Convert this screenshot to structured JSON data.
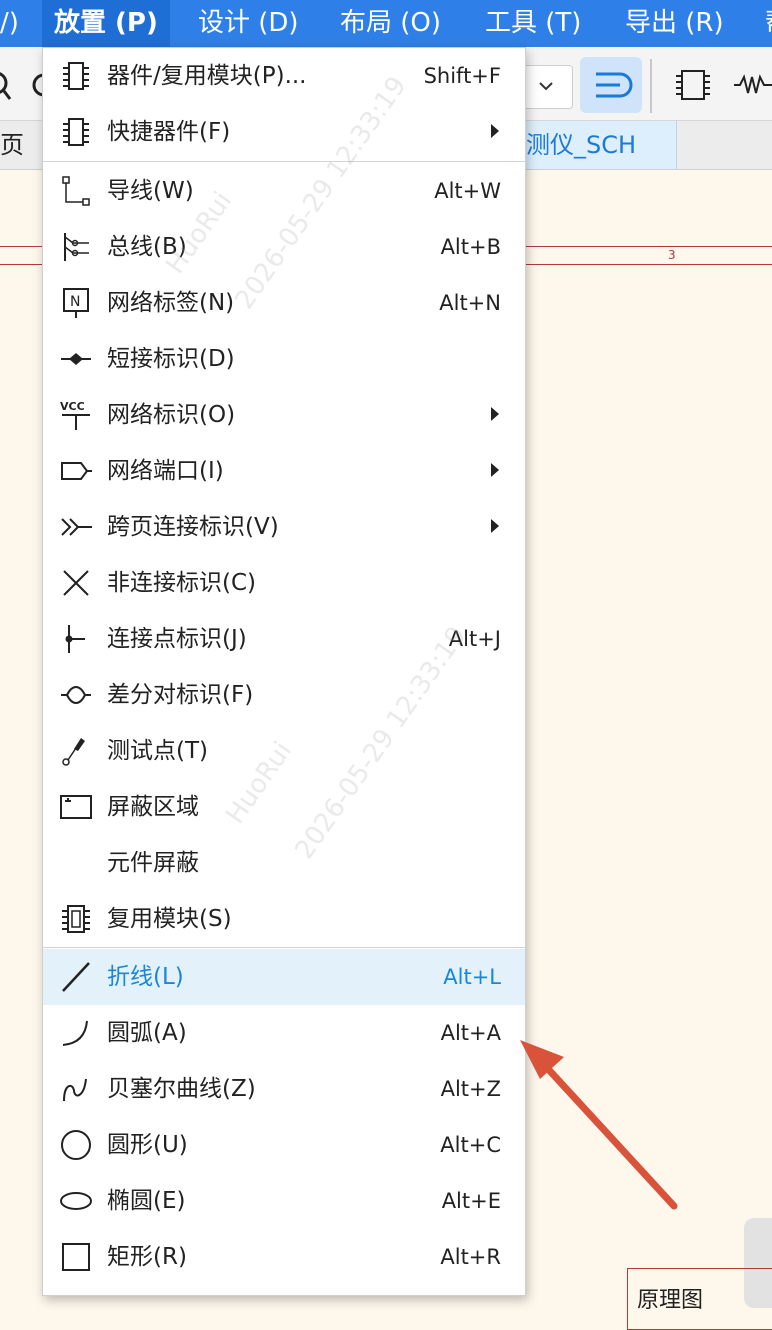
{
  "menubar": {
    "items": [
      {
        "label": "/)"
      },
      {
        "label": "放置 (P)"
      },
      {
        "label": "设计 (D)"
      },
      {
        "label": "布局 (O)"
      },
      {
        "label": "工具 (T)"
      },
      {
        "label": "导出 (R)"
      },
      {
        "label": "帮"
      }
    ]
  },
  "tabs": {
    "left_label": "页",
    "sch_label": "测仪_SCH"
  },
  "canvas": {
    "ruler_number": "3",
    "title_block_text": "原理图"
  },
  "menu": {
    "items": [
      {
        "label": "器件/复用模块(P)...",
        "shortcut": "Shift+F",
        "icon": "chip-icon"
      },
      {
        "label": "快捷器件(F)",
        "shortcut": "",
        "icon": "chip-icon",
        "submenu": true
      },
      {
        "label": "导线(W)",
        "shortcut": "Alt+W",
        "icon": "wire-icon"
      },
      {
        "label": "总线(B)",
        "shortcut": "Alt+B",
        "icon": "bus-icon"
      },
      {
        "label": "网络标签(N)",
        "shortcut": "Alt+N",
        "icon": "net-label-icon"
      },
      {
        "label": "短接标识(D)",
        "shortcut": "",
        "icon": "short-flag-icon"
      },
      {
        "label": "网络标识(O)",
        "shortcut": "",
        "icon": "vcc-icon",
        "submenu": true
      },
      {
        "label": "网络端口(I)",
        "shortcut": "",
        "icon": "net-port-icon",
        "submenu": true
      },
      {
        "label": "跨页连接标识(V)",
        "shortcut": "",
        "icon": "off-page-icon",
        "submenu": true
      },
      {
        "label": "非连接标识(C)",
        "shortcut": "",
        "icon": "no-connect-icon"
      },
      {
        "label": "连接点标识(J)",
        "shortcut": "Alt+J",
        "icon": "junction-icon"
      },
      {
        "label": "差分对标识(F)",
        "shortcut": "",
        "icon": "diff-pair-icon"
      },
      {
        "label": "测试点(T)",
        "shortcut": "",
        "icon": "test-point-icon"
      },
      {
        "label": "屏蔽区域",
        "shortcut": "",
        "icon": "shield-area-icon"
      },
      {
        "label": "元件屏蔽",
        "shortcut": "",
        "icon": ""
      },
      {
        "label": "复用模块(S)",
        "shortcut": "",
        "icon": "reuse-block-icon"
      },
      {
        "label": "折线(L)",
        "shortcut": "Alt+L",
        "icon": "polyline-icon",
        "highlighted": true
      },
      {
        "label": "圆弧(A)",
        "shortcut": "Alt+A",
        "icon": "arc-icon"
      },
      {
        "label": "贝塞尔曲线(Z)",
        "shortcut": "Alt+Z",
        "icon": "bezier-icon"
      },
      {
        "label": "圆形(U)",
        "shortcut": "Alt+C",
        "icon": "circle-icon"
      },
      {
        "label": "椭圆(E)",
        "shortcut": "Alt+E",
        "icon": "ellipse-icon"
      },
      {
        "label": "矩形(R)",
        "shortcut": "Alt+R",
        "icon": "rectangle-icon"
      }
    ]
  },
  "watermark": {
    "text": "2026-05-29 12:33:19",
    "user": "HuoRui"
  },
  "colors": {
    "menubar": "#2f7fe8",
    "highlight_bg": "#e3f1fb",
    "highlight_text": "#1a86d9",
    "arrow": "#d9523a",
    "schematic_line": "#b43a3a"
  }
}
